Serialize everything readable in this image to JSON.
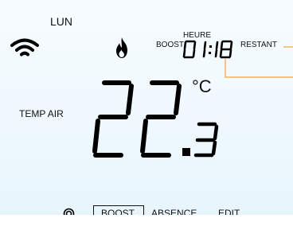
{
  "day": "LUN",
  "header": {
    "heure_label": "HEURE",
    "boost_label": "BOOST",
    "restant_label": "RESTANT",
    "timer_value": "01:18"
  },
  "temperature": {
    "label": "TEMP AIR",
    "value": "22.3",
    "unit": "°C"
  },
  "footer": {
    "boost": "BOOST",
    "absence": "ABSENCE",
    "edit": "EDIT"
  },
  "icons": {
    "wifi": "wifi-icon",
    "flame": "flame-icon",
    "power": "power-icon"
  },
  "colors": {
    "screen_bg": "#eef8fe",
    "segment": "#000000",
    "leader_line": "#f2a33a"
  }
}
